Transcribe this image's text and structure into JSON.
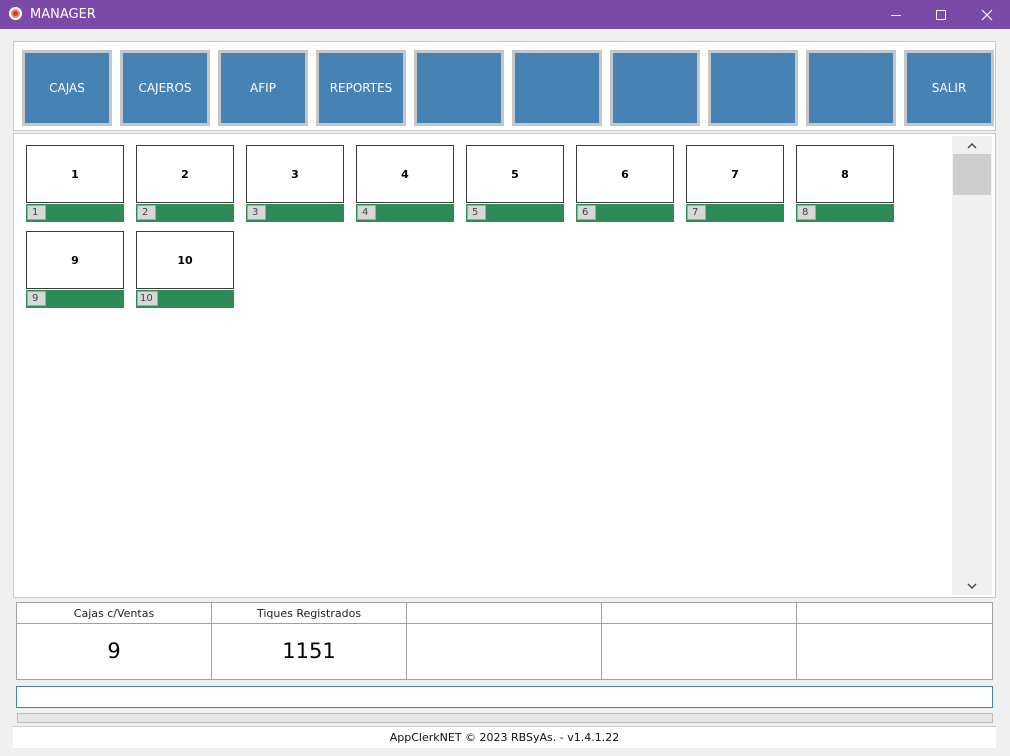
{
  "window": {
    "title": "MANAGER",
    "title_color": "#7b4aa8",
    "controls": [
      "minimize-icon",
      "maximize-icon",
      "close-icon"
    ]
  },
  "toolbar": {
    "button_color": "#4682b4",
    "buttons": [
      {
        "label": "CAJAS"
      },
      {
        "label": "CAJEROS"
      },
      {
        "label": "AFIP"
      },
      {
        "label": "REPORTES"
      },
      {
        "label": ""
      },
      {
        "label": ""
      },
      {
        "label": ""
      },
      {
        "label": ""
      },
      {
        "label": ""
      },
      {
        "label": "SALIR"
      }
    ]
  },
  "registers": {
    "status_color": "#2e8b57",
    "items": [
      {
        "title": "1",
        "badge": "1"
      },
      {
        "title": "2",
        "badge": "2"
      },
      {
        "title": "3",
        "badge": "3"
      },
      {
        "title": "4",
        "badge": "4"
      },
      {
        "title": "5",
        "badge": "5"
      },
      {
        "title": "6",
        "badge": "6"
      },
      {
        "title": "7",
        "badge": "7"
      },
      {
        "title": "8",
        "badge": "8"
      },
      {
        "title": "9",
        "badge": "9"
      },
      {
        "title": "10",
        "badge": "10"
      }
    ]
  },
  "stats": [
    {
      "label": "Cajas c/Ventas",
      "value": "9"
    },
    {
      "label": "Tiques Registrados",
      "value": "1151"
    },
    {
      "label": "",
      "value": ""
    },
    {
      "label": "",
      "value": ""
    },
    {
      "label": "",
      "value": ""
    }
  ],
  "command": {
    "value": ""
  },
  "footer": {
    "text": "AppClerkNET © 2023 RBSyAs. - v1.4.1.22"
  }
}
